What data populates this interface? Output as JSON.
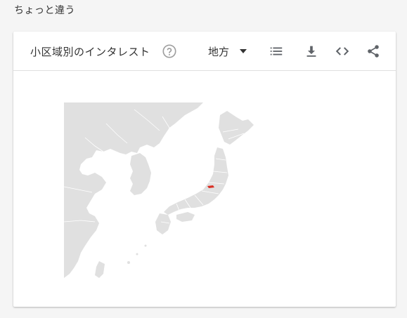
{
  "page": {
    "heading": "ちょっと違う"
  },
  "card": {
    "title": "小区域別のインタレスト",
    "help_icon": "help-circle-icon",
    "region_select": {
      "selected": "地方",
      "caret_icon": "triangle-down-icon"
    },
    "toolbar": {
      "list_icon": "list-icon",
      "download_icon": "download-icon",
      "embed_icon": "code-embed-icon",
      "share_icon": "share-icon"
    }
  },
  "colors": {
    "background": "#f5f5f5",
    "card": "#ffffff",
    "land": "#e0e0e0",
    "sea": "#ffffff",
    "borders": "#ffffff",
    "icon": "#5f6368",
    "highlight": "#d93025"
  },
  "map": {
    "highlighted_region": "red-mark"
  }
}
